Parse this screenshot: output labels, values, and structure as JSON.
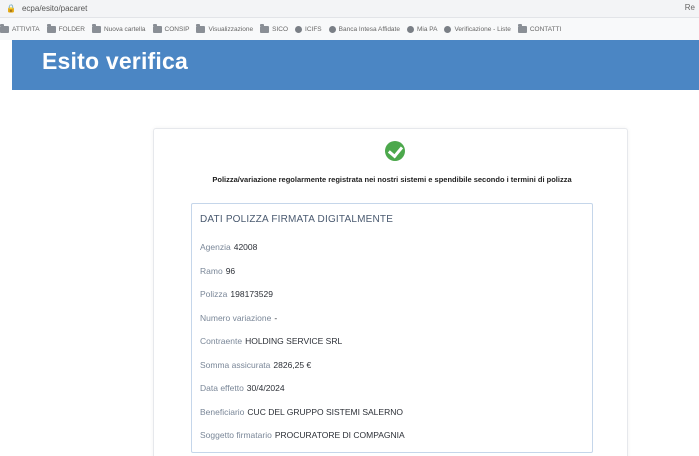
{
  "browser": {
    "url": "ecpa/esito/pacaret",
    "right_text": "Re",
    "bookmarks": [
      {
        "label": "ATTIVITA",
        "icon": "folder-icon"
      },
      {
        "label": "FOLDER",
        "icon": "folder-icon"
      },
      {
        "label": "Nuova cartella",
        "icon": "folder-icon"
      },
      {
        "label": "CONSIP",
        "icon": "folder-icon"
      },
      {
        "label": "Visualizzazione",
        "icon": "folder-icon"
      },
      {
        "label": "SICO",
        "icon": "folder-icon"
      },
      {
        "label": "ICIFS",
        "icon": "site-icon"
      },
      {
        "label": "Banca Intesa Affidate",
        "icon": "site-icon"
      },
      {
        "label": "Mia PA",
        "icon": "site-icon"
      },
      {
        "label": "Verificazione - Liste",
        "icon": "site-icon"
      },
      {
        "label": "CONTATTI",
        "icon": "folder-icon"
      }
    ]
  },
  "header": {
    "title": "Esito verifica"
  },
  "result": {
    "status_icon": "check-circle-icon",
    "status_color": "#4ca84c",
    "message": "Polizza/variazione regolarmente registrata nei nostri sistemi e spendibile secondo i termini di polizza"
  },
  "details": {
    "title": "DATI POLIZZA FIRMATA DIGITALMENTE",
    "fields": [
      {
        "label": "Agenzia",
        "value": "42008"
      },
      {
        "label": "Ramo",
        "value": "96"
      },
      {
        "label": "Polizza",
        "value": "198173529"
      },
      {
        "label": "Numero variazione",
        "value": "-"
      },
      {
        "label": "Contraente",
        "value": "HOLDING SERVICE SRL"
      },
      {
        "label": "Somma assicurata",
        "value": "2826,25 €"
      },
      {
        "label": "Data effetto",
        "value": "30/4/2024"
      },
      {
        "label": "Beneficiario",
        "value": "CUC DEL GRUPPO SISTEMI SALERNO"
      },
      {
        "label": "Soggetto firmatario",
        "value": "PROCURATORE DI COMPAGNIA"
      }
    ]
  },
  "colors": {
    "banner": "#4b86c4",
    "accent_border": "#c5d6ea"
  }
}
